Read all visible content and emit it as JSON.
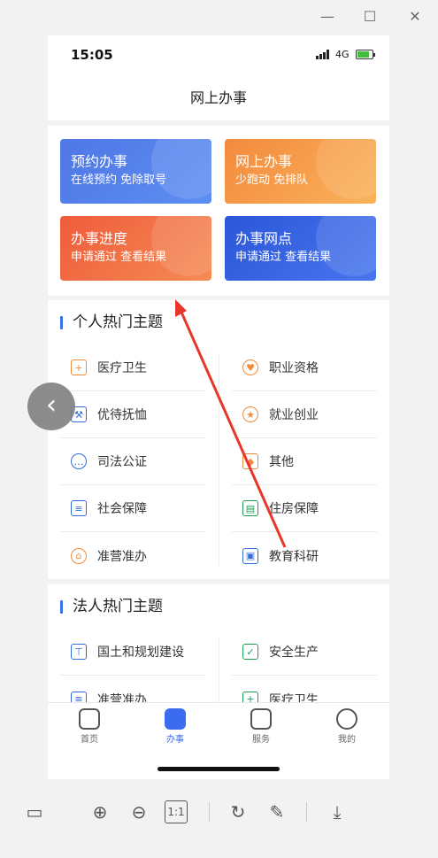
{
  "window": {
    "minimize": "—",
    "maximize": "☐",
    "close": "✕"
  },
  "status": {
    "time": "15:05",
    "network": "4G"
  },
  "page_title": "网上办事",
  "cards": [
    {
      "title": "预约办事",
      "subtitle": "在线预约 免除取号"
    },
    {
      "title": "网上办事",
      "subtitle": "少跑动 免排队"
    },
    {
      "title": "办事进度",
      "subtitle": "申请通过 查看结果"
    },
    {
      "title": "办事网点",
      "subtitle": "申请通过 查看结果"
    }
  ],
  "personal": {
    "title": "个人热门主题",
    "left": [
      "医疗卫生",
      "优待抚恤",
      "司法公证",
      "社会保障",
      "准营准办"
    ],
    "right": [
      "职业资格",
      "就业创业",
      "其他",
      "住房保障",
      "教育科研"
    ]
  },
  "legal": {
    "title": "法人热门主题",
    "left": [
      "国土和规划建设",
      "准营准办"
    ],
    "right": [
      "安全生产",
      "医疗卫生"
    ]
  },
  "tabs": [
    "首页",
    "办事",
    "服务",
    "我的"
  ],
  "colors": {
    "accent": "#3b6cf0",
    "arrow": "#e8362a"
  }
}
